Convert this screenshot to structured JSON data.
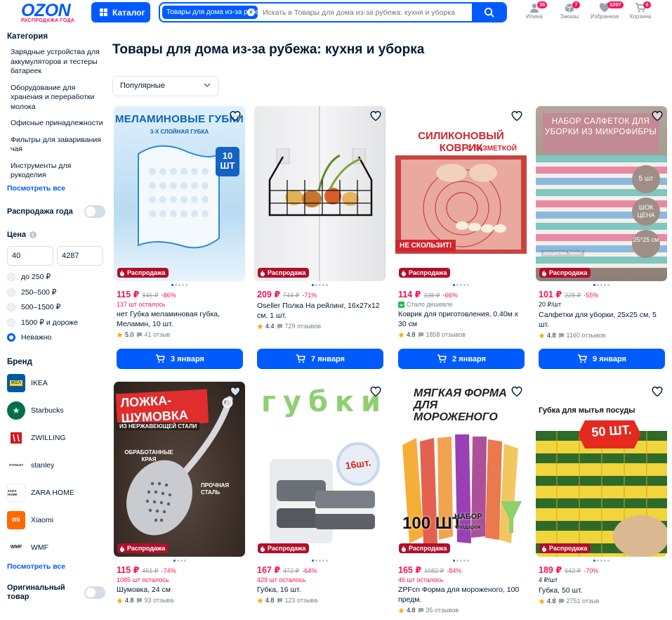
{
  "header": {
    "logo": "OZON",
    "logo_sub": "РАСПРОДАЖА ГОДА",
    "catalog_label": "Каталог",
    "search_chip": "Товары для дома из-за рубежа: кухня и уборка",
    "search_placeholder": "Искать в Товары для дома из-за рубежа: кухня и уборка",
    "nav": [
      {
        "label": "Илина",
        "badge": "35",
        "icon": "user-icon"
      },
      {
        "label": "Заказы",
        "badge": "7",
        "icon": "box-icon"
      },
      {
        "label": "Избранное",
        "badge": "1097",
        "icon": "heart-icon"
      },
      {
        "label": "Корзина",
        "badge": "6",
        "icon": "cart-icon"
      }
    ]
  },
  "sidebar": {
    "category_title": "Категория",
    "categories": [
      "Зарядные устройства для аккумуляторов и тестеры батареек",
      "Оборудование для хранения и переработки молока",
      "Офисные принадлежности",
      "Фильтры для заваривания чая",
      "Инструменты для рукоделия"
    ],
    "see_all": "Посмотреть все",
    "sale_toggle": "Распродажа года",
    "price_title": "Цена",
    "price_from": "40",
    "price_to": "4287",
    "price_options": [
      "до 250 ₽",
      "250–500 ₽",
      "500–1500 ₽",
      "1500 ₽ и дороже",
      "Неважно"
    ],
    "price_selected": "Неважно",
    "brand_title": "Бренд",
    "brands": [
      {
        "name": "IKEA",
        "color": "#0058a3",
        "mark": "IKEA"
      },
      {
        "name": "Starbucks",
        "color": "#00704a",
        "mark": "★"
      },
      {
        "name": "ZWILLING",
        "color": "#d2141e",
        "mark": "ZW"
      },
      {
        "name": "stanley",
        "color": "#1c1c1c",
        "mark": "STANLEY"
      },
      {
        "name": "ZARA HOME",
        "color": "#ffffff",
        "mark": "ZARA HOME"
      },
      {
        "name": "Xiaomi",
        "color": "#ff6900",
        "mark": "mi"
      },
      {
        "name": "WMF",
        "color": "#ffffff",
        "mark": "WMF"
      }
    ],
    "brands_see_all": "Посмотреть все",
    "original_toggle": "Оригинальный товар"
  },
  "main": {
    "title": "Товары для дома из-за рубежа: кухня и уборка",
    "sort_value": "Популярные"
  },
  "products": [
    {
      "price": "115 ₽",
      "old": "845 ₽",
      "disc": "-86%",
      "extra": "137 шт осталось",
      "extra_type": "stock",
      "name": "нет Губка меламиновая губка, Меламин, 10 шт.",
      "rating": "5.0",
      "reviews": "41 отзыв",
      "delivery": "3 января",
      "badge": "Распродажа",
      "img_text": "МЕЛАМИНОВЫЕ ГУБКИ",
      "img_sub": "3-Х СЛОЙНАЯ ГУБКА",
      "img_extra": "10 ШТ"
    },
    {
      "price": "209 ₽",
      "old": "744 ₽",
      "disc": "-71%",
      "extra": "",
      "extra_type": "none",
      "name": "Oseller Полка На рейлинг, 16x27x12 см, 1 шт.",
      "rating": "4.4",
      "reviews": "729 отзывов",
      "delivery": "7 января",
      "badge": "Распродажа",
      "img_text": "",
      "img_sub": "",
      "img_extra": ""
    },
    {
      "price": "114 ₽",
      "old": "338 ₽",
      "disc": "-66%",
      "extra": "Стало дешевле",
      "extra_type": "cheaper",
      "name": "Коврик для приготовления, 0.40м x 30 см",
      "rating": "4.8",
      "reviews": "1858 отзывов",
      "delivery": "2 января",
      "badge": "Распродажа",
      "img_text": "СИЛИКОНОВЫЙ КОВРИК",
      "img_sub": "С РАЗМЕТКОЙ",
      "img_extra": "НЕ СКОЛЬЗИТ!"
    },
    {
      "price": "101 ₽",
      "old": "228 ₽",
      "disc": "-55%",
      "extra": "20 ₽/шт",
      "extra_type": "unit",
      "name": "Салфетки для уборки, 25x25 см, 5 шт.",
      "rating": "4.8",
      "reviews": "1160 отзывов",
      "delivery": "9 января",
      "badge": "Распродажа",
      "img_text": "НАБОР САЛФЕТОК ДЛЯ УБОРКИ ИЗ МИКРОФИБРЫ",
      "img_sub": "5 шт",
      "img_extra": "ШОК ЦЕНА",
      "img_extra2": "25*25 см",
      "img_note": "расцветка \"микс\""
    },
    {
      "price": "115 ₽",
      "old": "451 ₽",
      "disc": "-74%",
      "extra": "1085 шт осталось",
      "extra_type": "stock",
      "name": "Шумовка, 24 см",
      "rating": "4.8",
      "reviews": "93 отзыва",
      "delivery": "",
      "badge": "Распродажа",
      "img_text": "ЛОЖКА-ШУМОВКА",
      "img_sub": "ИЗ НЕРЖАВЕЮЩЕЙ СТАЛИ",
      "img_extra": "ОБРАБОТАННЫЕ КРАЯ",
      "img_extra2": "ПРОЧНАЯ СТАЛЬ"
    },
    {
      "price": "167 ₽",
      "old": "472 ₽",
      "disc": "-64%",
      "extra": "429 шт осталось",
      "extra_type": "stock",
      "name": "Губка, 16 шт.",
      "rating": "4.8",
      "reviews": "123 отзыва",
      "delivery": "",
      "badge": "Распродажа",
      "img_text": "губки",
      "img_sub": "16шт.",
      "img_extra": ""
    },
    {
      "price": "165 ₽",
      "old": "1082 ₽",
      "disc": "-84%",
      "extra": "46 шт осталось",
      "extra_type": "stock",
      "name": "ZPFcn Форма для мороженого, 100 предм.",
      "rating": "4.8",
      "reviews": "35 отзывов",
      "delivery": "",
      "badge": "Распродажа",
      "img_text": "МЯГКАЯ ФОРМА ДЛЯ МОРОЖЕНОГО",
      "img_sub": "100 ШТ",
      "img_extra": "НАБОР",
      "img_extra2": "+подарок"
    },
    {
      "price": "189 ₽",
      "old": "642 ₽",
      "disc": "-70%",
      "extra": "4 ₽/шт",
      "extra_type": "unit",
      "name": "Губка, 50 шт.",
      "rating": "4.8",
      "reviews": "2751 отзыв",
      "delivery": "",
      "badge": "Распродажа",
      "img_text": "Губка для мытья посуды",
      "img_sub": "50 ШТ.",
      "img_extra": ""
    }
  ]
}
